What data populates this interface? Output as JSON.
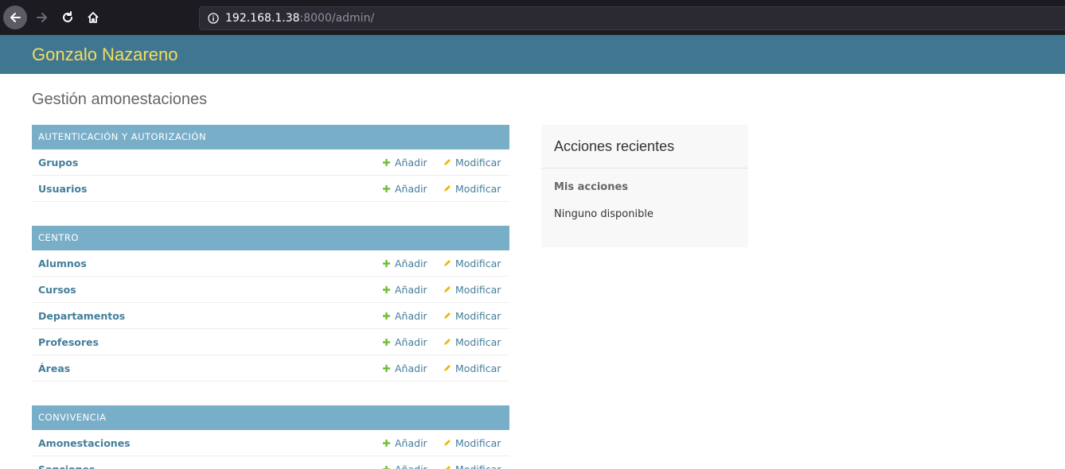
{
  "browser": {
    "url_host": "192.168.1.38",
    "url_rest": ":8000/admin/"
  },
  "header": {
    "site_name": "Gonzalo Nazareno"
  },
  "page": {
    "title": "Gestión amonestaciones"
  },
  "actions": {
    "add_label": "Añadir",
    "change_label": "Modificar"
  },
  "modules": [
    {
      "caption": "Autenticación y autorización",
      "models": [
        {
          "name": "Grupos"
        },
        {
          "name": "Usuarios"
        }
      ]
    },
    {
      "caption": "Centro",
      "models": [
        {
          "name": "Alumnos"
        },
        {
          "name": "Cursos"
        },
        {
          "name": "Departamentos"
        },
        {
          "name": "Profesores"
        },
        {
          "name": "Áreas"
        }
      ]
    },
    {
      "caption": "Convivencia",
      "models": [
        {
          "name": "Amonestaciones"
        },
        {
          "name": "Sanciones"
        }
      ]
    }
  ],
  "recent_actions": {
    "title": "Acciones recientes",
    "subtitle": "Mis acciones",
    "empty": "Ninguno disponible"
  },
  "colors": {
    "header_bg": "#417690",
    "site_name": "#f5dd5d",
    "caption_bg": "#79aec8",
    "link": "#447e9b",
    "add_icon": "#70bf2b",
    "change_icon": "#efb80b"
  }
}
